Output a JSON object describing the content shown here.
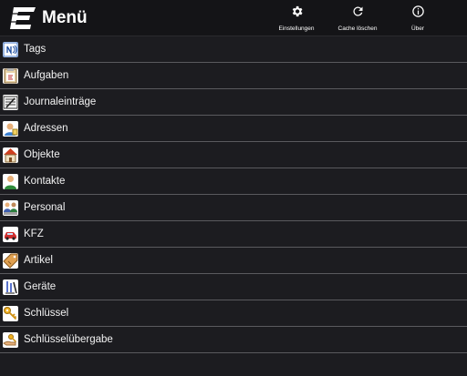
{
  "header": {
    "title": "Menü",
    "actions": [
      {
        "label": "Einstellungen",
        "icon": "gear-icon"
      },
      {
        "label": "Cache löschen",
        "icon": "refresh-icon"
      },
      {
        "label": "Über",
        "icon": "info-icon"
      }
    ]
  },
  "menu": {
    "items": [
      {
        "label": "Tags",
        "icon": "nfc-tag-icon"
      },
      {
        "label": "Aufgaben",
        "icon": "clipboard-task-icon"
      },
      {
        "label": "Journaleinträge",
        "icon": "journal-icon"
      },
      {
        "label": "Adressen",
        "icon": "address-person-icon"
      },
      {
        "label": "Objekte",
        "icon": "house-icon"
      },
      {
        "label": "Kontakte",
        "icon": "contact-person-icon"
      },
      {
        "label": "Personal",
        "icon": "staff-group-icon"
      },
      {
        "label": "KFZ",
        "icon": "car-icon"
      },
      {
        "label": "Artikel",
        "icon": "price-tag-icon"
      },
      {
        "label": "Geräte",
        "icon": "tools-icon"
      },
      {
        "label": "Schlüssel",
        "icon": "key-icon"
      },
      {
        "label": "Schlüsselübergabe",
        "icon": "key-handover-icon"
      }
    ]
  },
  "colors": {
    "background": "#1c1c20",
    "topbar": "#141417",
    "divider": "#5a5a5e",
    "text": "#f2f2f2"
  }
}
